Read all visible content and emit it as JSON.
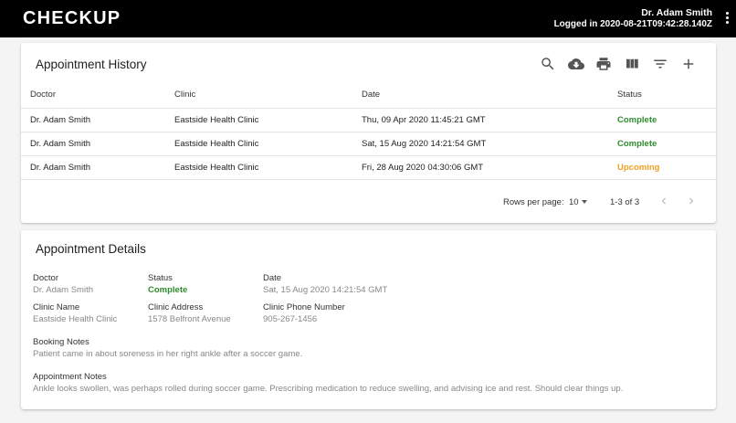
{
  "app": {
    "logo": "CHECKUP"
  },
  "user": {
    "name": "Dr. Adam Smith",
    "logged_in": "Logged in 2020-08-21T09:42:28.140Z"
  },
  "history": {
    "title": "Appointment History",
    "toolbar": [
      "search-icon",
      "cloud-download-icon",
      "print-icon",
      "view-column-icon",
      "filter-list-icon",
      "add-icon"
    ],
    "columns": {
      "doctor": "Doctor",
      "clinic": "Clinic",
      "date": "Date",
      "status": "Status"
    },
    "rows": [
      {
        "doctor": "Dr. Adam Smith",
        "clinic": "Eastside Health Clinic",
        "date": "Thu, 09 Apr 2020 11:45:21 GMT",
        "status": "Complete"
      },
      {
        "doctor": "Dr. Adam Smith",
        "clinic": "Eastside Health Clinic",
        "date": "Sat, 15 Aug 2020 14:21:54 GMT",
        "status": "Complete"
      },
      {
        "doctor": "Dr. Adam Smith",
        "clinic": "Eastside Health Clinic",
        "date": "Fri, 28 Aug 2020 04:30:06 GMT",
        "status": "Upcoming"
      }
    ],
    "pagination": {
      "rows_per_page_label": "Rows per page:",
      "rows_per_page": "10",
      "range": "1-3 of 3"
    }
  },
  "details": {
    "title": "Appointment Details",
    "doctor": {
      "label": "Doctor",
      "value": "Dr. Adam Smith"
    },
    "status": {
      "label": "Status",
      "value": "Complete"
    },
    "date": {
      "label": "Date",
      "value": "Sat, 15 Aug 2020 14:21:54 GMT"
    },
    "clinic_name": {
      "label": "Clinic Name",
      "value": "Eastside Health Clinic"
    },
    "clinic_address": {
      "label": "Clinic Address",
      "value": "1578 Belfront Avenue"
    },
    "clinic_phone": {
      "label": "Clinic Phone Number",
      "value": "905-267-1456"
    },
    "booking_notes": {
      "label": "Booking Notes",
      "value": "Patient came in about soreness in her right ankle after a soccer game."
    },
    "appointment_notes": {
      "label": "Appointment Notes",
      "value": "Ankle looks swollen, was perhaps rolled during soccer game. Prescribing medication to reduce swelling, and advising ice and rest. Should clear things up."
    }
  },
  "colors": {
    "complete": "#2e8b2e",
    "upcoming": "#f0a020",
    "topbar": "#000000"
  }
}
